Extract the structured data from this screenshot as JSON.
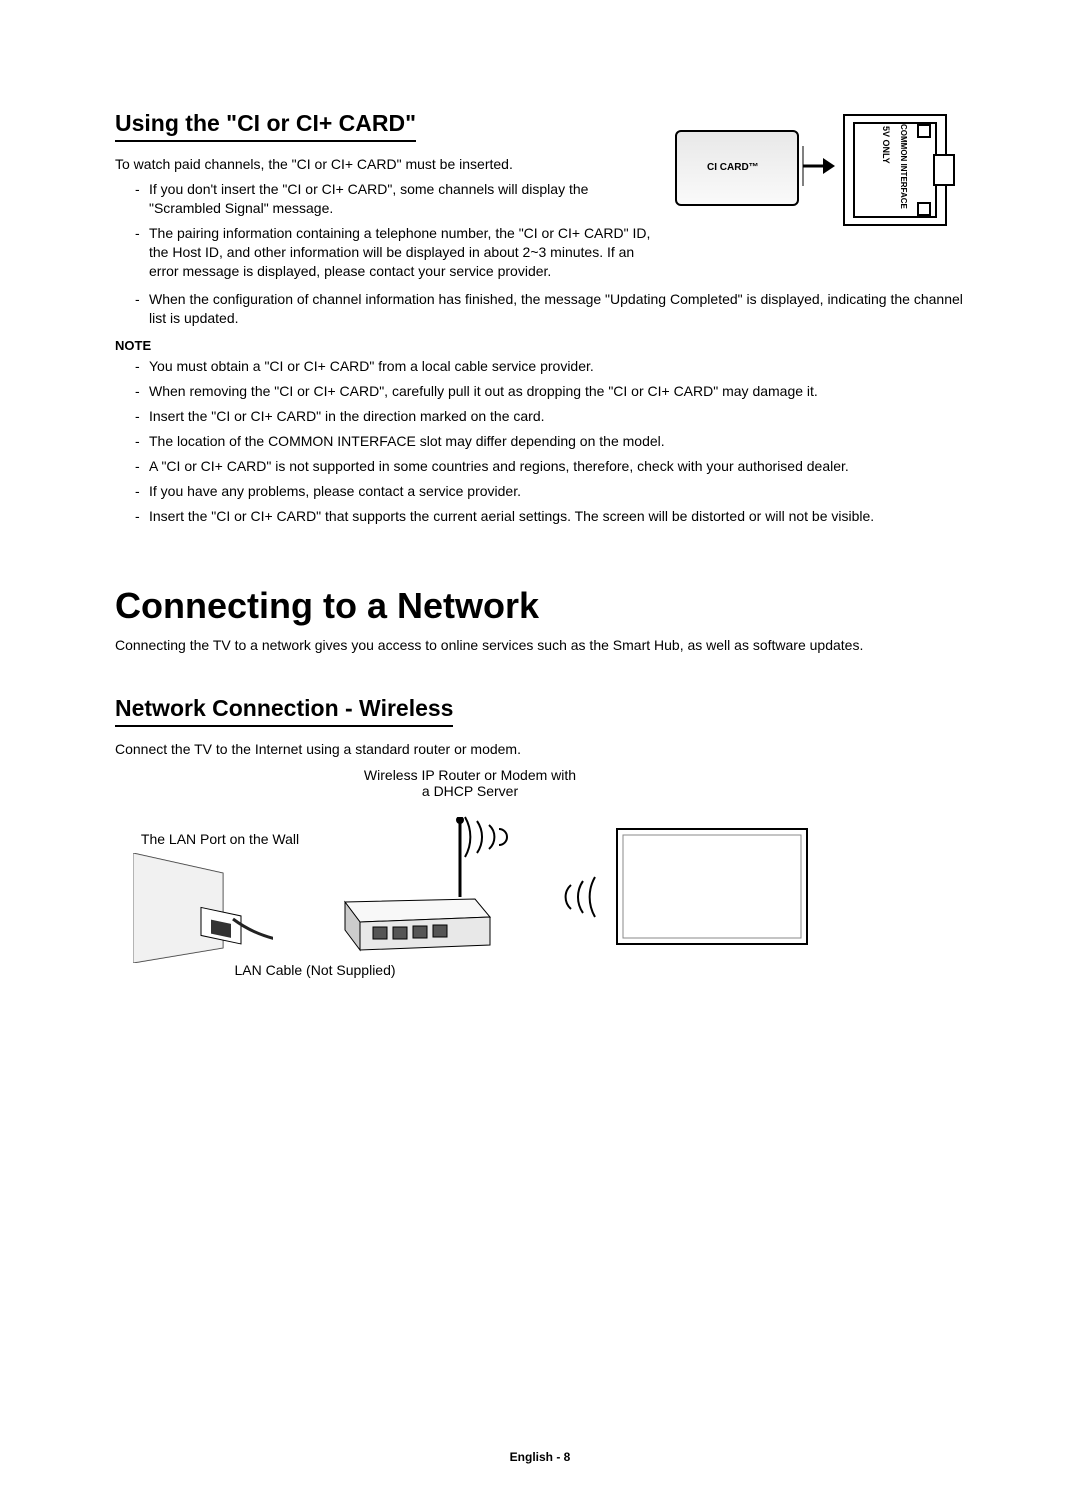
{
  "section1": {
    "title": "Using the \"CI or CI+ CARD\"",
    "intro": "To watch paid channels, the \"CI or CI+ CARD\" must be inserted.",
    "bullets_left": [
      "If you don't insert the \"CI or CI+ CARD\", some channels will display the \"Scrambled Signal\" message.",
      "The pairing information containing a telephone number, the \"CI or CI+ CARD\" ID, the Host ID, and other information will be displayed in about 2~3 minutes. If an error message is displayed, please contact your service provider."
    ],
    "bullets_full": [
      "When the configuration of channel information has finished, the message \"Updating Completed\" is displayed, indicating the channel list is updated."
    ],
    "note_label": "NOTE",
    "note_bullets": [
      "You must obtain a \"CI or CI+ CARD\" from a local cable service provider.",
      "When removing the \"CI or CI+ CARD\", carefully pull it out as dropping the \"CI or CI+ CARD\" may damage it.",
      "Insert the \"CI or CI+ CARD\" in the direction marked on the card.",
      "The location of the COMMON INTERFACE slot may differ depending on the model.",
      "A \"CI or CI+ CARD\" is not supported in some countries and regions, therefore, check with your authorised dealer.",
      "If you have any problems, please contact a service provider.",
      "Insert the \"CI or CI+ CARD\" that supports the current aerial settings. The screen will be distorted or will not be visible."
    ],
    "ci_card_label": "CI CARD™",
    "slot_label1": "5V ONLY",
    "slot_label2": "COMMON INTERFACE"
  },
  "section2": {
    "title": "Connecting to a Network",
    "intro": "Connecting the TV to a network gives you access to online services such as the Smart Hub, as well as software updates."
  },
  "section3": {
    "title": "Network Connection - Wireless",
    "intro": "Connect the TV to the Internet using a standard router or modem.",
    "router_label_l1": "Wireless IP Router or Modem with",
    "router_label_l2": "a DHCP Server",
    "wall_label": "The LAN Port on the Wall",
    "cable_label": "LAN Cable (Not Supplied)"
  },
  "footer": "English - 8"
}
